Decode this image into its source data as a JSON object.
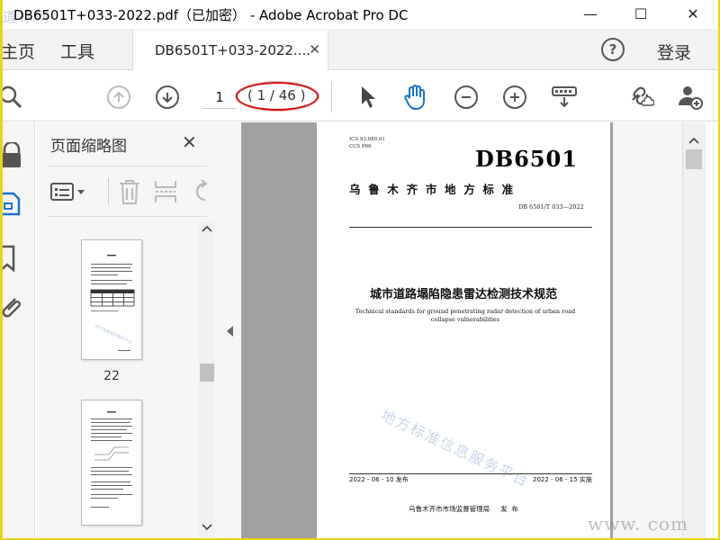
{
  "window": {
    "title": "DB6501T+033-2022.pdf（已加密） - Adobe Acrobat Pro DC",
    "corner_watermark": "道标网",
    "minimize": "—",
    "maximize": "☐",
    "close": "✕"
  },
  "tabs": {
    "home": "主页",
    "tools": "工具",
    "document": "DB6501T+033-2022....",
    "document_close": "✕",
    "help": "?",
    "login": "登录"
  },
  "toolbar": {
    "current_page": "1",
    "page_count": "( 1 / 46 )"
  },
  "panel": {
    "title": "页面缩略图",
    "close": "✕",
    "thumb1_label": "22"
  },
  "pdf_page": {
    "ics": "ICS  93.080.01",
    "ccs": "CCS  P66",
    "header": "DB6501",
    "region": "乌  鲁  木  齐  市  地  方  标  准",
    "doc_no": "DB 6501/T  033—2022",
    "title_cn": "城市道路塌陷隐患雷达检测技术规范",
    "title_en": "Technical standards for ground penetrating radar detection of urban road collapse vulnerabilities",
    "watermark": "地方标准信息服务平台",
    "issue_date": "2022 - 06 - 10 发布",
    "impl_date": "2022 - 06 - 15 实施",
    "issuer": "乌鲁木齐市市场监督管理局     发  布"
  },
  "bottom_watermark": "www.    com",
  "colors": {
    "highlight": "#d01010",
    "outer_border": "#e8d51a",
    "viewer_bg": "#a0a0a0"
  }
}
